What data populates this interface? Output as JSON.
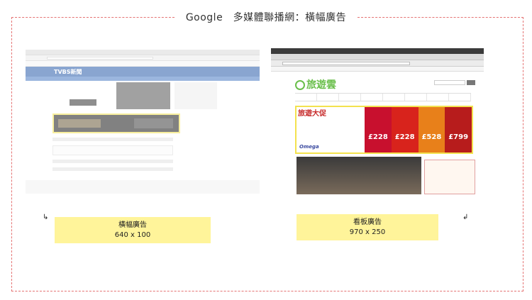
{
  "title": "Google　多媒體聯播網：橫幅廣告",
  "left_screenshot": {
    "site_logo": "TVBS新聞"
  },
  "right_screenshot": {
    "site_logo": "旅遊雲",
    "billboard": {
      "headline": "旅遊大促",
      "brand": "Omega",
      "prices": [
        "£228",
        "£228",
        "£528",
        "£799"
      ]
    }
  },
  "labels": [
    {
      "name": "橫幅廣告",
      "size": "640 x 100"
    },
    {
      "name": "看板廣告",
      "size": "970 x 250"
    }
  ],
  "arrows": {
    "left": "↳",
    "right": "↲"
  },
  "colors": {
    "frame": "#e57373",
    "highlight": "#fff49a",
    "ad_border": "#f3e24e"
  }
}
